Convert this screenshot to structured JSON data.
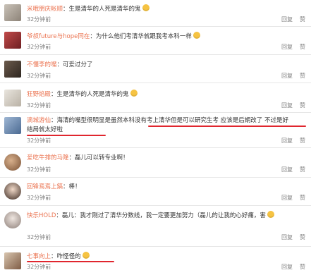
{
  "comments": [
    {
      "user": "米哦朋庆帐顺",
      "text": "生是清华的人死是清华的鬼",
      "time": "32分钟前",
      "reply": "回复",
      "like": "赞",
      "emoji": true
    },
    {
      "user": "爷叔future与hope同在",
      "text": "为什么他们考清华就跟我考本科一样",
      "time": "32分钟前",
      "reply": "回复",
      "like": "赞",
      "emoji": true
    },
    {
      "user": "不懂李的嘴",
      "text": "可爱过分了",
      "time": "32分钟前",
      "reply": "回复",
      "like": "赞",
      "emoji": false
    },
    {
      "user": "狂野焰殿",
      "text": "生是清华的人死是清华的鬼",
      "time": "32分钟前",
      "reply": "回复",
      "like": "赞",
      "emoji": true
    },
    {
      "user": "滴城游仙",
      "text": "海清的嘴型很明显是虽然本科没有考上清华但是可以研究生考 应该是后期改了 不过是好结局就太好啦",
      "time": "32分钟前",
      "reply": "回复",
      "like": "赞",
      "emoji": false
    },
    {
      "user": "爱吃牛排的马隆",
      "text": "磊儿可以转专业啊！",
      "time": "32分钟前",
      "reply": "回复",
      "like": "赞",
      "emoji": false
    },
    {
      "user": "回锋焉焉上鎬",
      "text": "棒！",
      "time": "32分钟前",
      "reply": "回复",
      "like": "赞",
      "emoji": false
    },
    {
      "user": "快乐HOLD",
      "text": "磊儿：我才刚过了清华分数线，我一定要更加努力（磊儿的让我的心好痛，害",
      "time": "32分钟前",
      "reply": "回复",
      "like": "赞",
      "emoji": true
    },
    {
      "user": "七事向上",
      "text": "咋怪怪的",
      "time": "32分钟前",
      "reply": "回复",
      "like": "赞",
      "emoji": true
    }
  ],
  "colors": {
    "username": "#eb7350",
    "text": "#333333",
    "meta": "#808080",
    "highlight": "#e0262e"
  }
}
